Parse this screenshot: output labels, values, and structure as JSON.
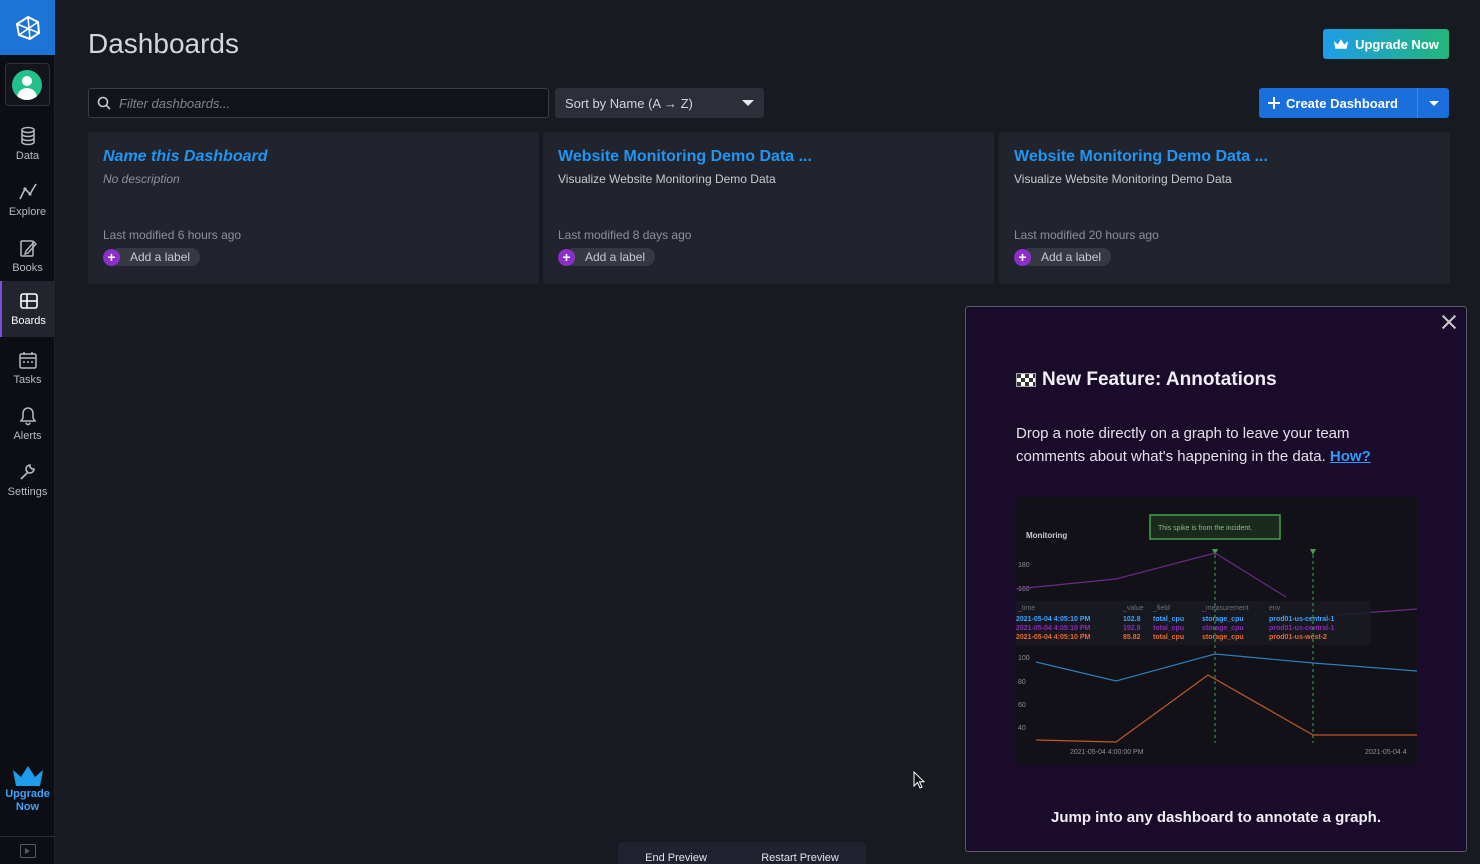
{
  "page": {
    "title": "Dashboards"
  },
  "header": {
    "upgrade_label": "Upgrade Now"
  },
  "sidebar": {
    "items": [
      {
        "label": "Data",
        "icon": "database-icon"
      },
      {
        "label": "Explore",
        "icon": "graph-icon"
      },
      {
        "label": "Books",
        "icon": "notebook-icon"
      },
      {
        "label": "Boards",
        "icon": "dashboard-icon",
        "active": true
      },
      {
        "label": "Tasks",
        "icon": "calendar-icon"
      },
      {
        "label": "Alerts",
        "icon": "bell-icon"
      },
      {
        "label": "Settings",
        "icon": "wrench-icon"
      }
    ],
    "upgrade_line1": "Upgrade",
    "upgrade_line2": "Now"
  },
  "toolbar": {
    "search_placeholder": "Filter dashboards...",
    "sort_label": "Sort by Name (A → Z)",
    "create_label": "Create Dashboard"
  },
  "cards": [
    {
      "title": "Name this Dashboard",
      "description": "No description",
      "modified": "Last modified 6 hours ago",
      "label_action": "Add a label"
    },
    {
      "title": "Website Monitoring Demo Data ...",
      "description": "Visualize Website Monitoring Demo Data",
      "modified": "Last modified 8 days ago",
      "label_action": "Add a label"
    },
    {
      "title": "Website Monitoring Demo Data ...",
      "description": "Visualize Website Monitoring Demo Data",
      "modified": "Last modified 20 hours ago",
      "label_action": "Add a label"
    }
  ],
  "popup": {
    "title": "New Feature: Annotations",
    "body": "Drop a note directly on a graph to leave your team comments about what's happening in the data.",
    "link": "How?",
    "footer": "Jump into any dashboard to annotate a graph.",
    "image": {
      "heading": "Monitoring",
      "annotation": "This spike is from the incident.",
      "y_top": [
        "180",
        "160"
      ],
      "y_bottom": [
        "100",
        "80",
        "60",
        "40"
      ],
      "table_headers": [
        "_time",
        "_value",
        "_field",
        "_measurement",
        "env"
      ],
      "table_rows": [
        [
          "2021-05-04 4:05:10 PM",
          "102.8",
          "total_cpu",
          "storage_cpu",
          "prod01-us-central-1"
        ],
        [
          "2021-05-04 4:05:10 PM",
          "192.8",
          "total_cpu",
          "storage_cpu",
          "prod01-us-central-1"
        ],
        [
          "2021-05-04 4:05:10 PM",
          "85.82",
          "total_cpu",
          "storage_cpu",
          "prod01-us-west-2"
        ]
      ],
      "x_left": "2021-05-04 4:00:00 PM",
      "x_right": "2021-05-04 4"
    }
  },
  "preview": {
    "end_label": "End Preview",
    "restart_label": "Restart Preview"
  },
  "colors": {
    "accent": "#1a6fdc",
    "card_title": "#1e96f6",
    "label_plus": "#8c2ec9",
    "popup_bg": "#1a0b2a"
  }
}
